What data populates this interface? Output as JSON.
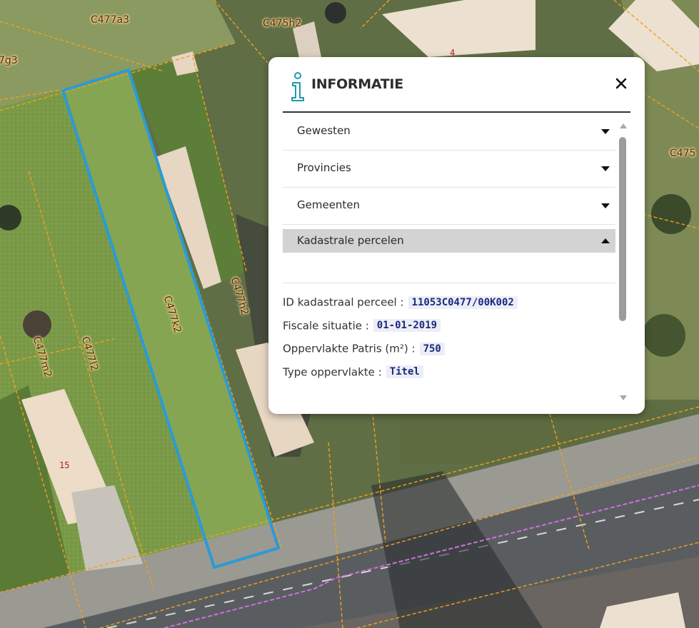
{
  "colors": {
    "accent_icon": "#1e9aa5",
    "selected_parcel": "#2a9bd6",
    "parcel_boundary": "#f0a020",
    "value_text": "#1c2a80"
  },
  "map": {
    "parcel_labels": [
      "C477a3",
      "C475h2",
      "7g3",
      "C477l2",
      "C477k2",
      "C477h2",
      "C477m2",
      "C475"
    ],
    "house_numbers": [
      "4",
      "15"
    ]
  },
  "panel": {
    "title": "INFORMATIE",
    "icon": "info-icon",
    "close_icon": "close-icon",
    "sections": [
      {
        "label": "Gewesten",
        "expanded": false
      },
      {
        "label": "Provincies",
        "expanded": false
      },
      {
        "label": "Gemeenten",
        "expanded": false
      },
      {
        "label": "Kadastrale percelen",
        "expanded": true
      }
    ],
    "details": [
      {
        "label": "ID kadastraal perceel :",
        "value": "11053C0477/00K002"
      },
      {
        "label": "Fiscale situatie :",
        "value": "01-01-2019"
      },
      {
        "label": "Oppervlakte Patris (m²) :",
        "value": "750"
      },
      {
        "label": "Type oppervlakte :",
        "value": "Titel"
      }
    ]
  }
}
